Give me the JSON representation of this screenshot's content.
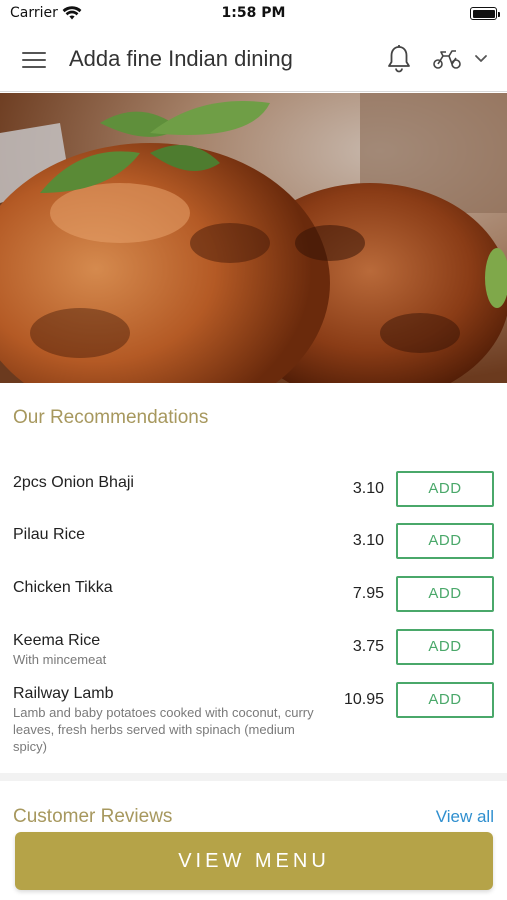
{
  "status_bar": {
    "carrier": "Carrier",
    "time": "1:58 PM"
  },
  "header": {
    "title": "Adda fine Indian dining",
    "menu_icon": "hamburger-menu-icon",
    "notification_icon": "bell-icon",
    "order_mode_icon": "delivery-scooter-icon",
    "dropdown_icon": "chevron-down-icon"
  },
  "hero": {
    "image": "tandoori-chicken-photo"
  },
  "recommendations": {
    "title": "Our Recommendations",
    "add_label": "ADD",
    "items": [
      {
        "name": "2pcs Onion Bhaji",
        "description": "",
        "price": "3.10"
      },
      {
        "name": "Pilau Rice",
        "description": "",
        "price": "3.10"
      },
      {
        "name": "Chicken Tikka",
        "description": "",
        "price": "7.95"
      },
      {
        "name": "Keema Rice",
        "description": "With mincemeat",
        "price": "3.75"
      },
      {
        "name": "Railway Lamb",
        "description": "Lamb and baby potatoes cooked with coconut, curry leaves, fresh herbs served with spinach (medium spicy)",
        "price": "10.95"
      }
    ]
  },
  "reviews": {
    "title": "Customer Reviews",
    "view_all_label": "View all"
  },
  "footer": {
    "view_menu_label": "VIEW MENU"
  },
  "colors": {
    "accent_gold": "#b5a348",
    "section_title": "#a7985e",
    "add_green": "#4aa86a",
    "link_blue": "#2f8fcf"
  }
}
